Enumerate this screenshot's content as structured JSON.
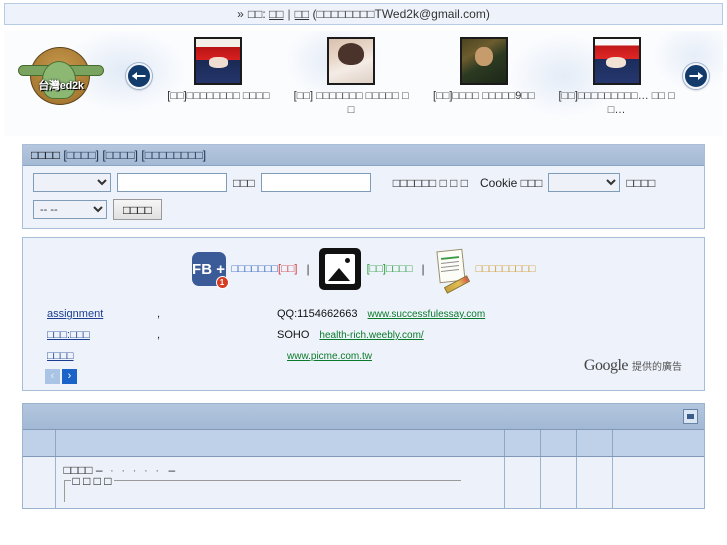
{
  "topbar": {
    "chevron": "»",
    "label_prefix": "□□:",
    "link_1": "□□",
    "separator": "|",
    "link_2": "□□",
    "paren_note": "(□□□□□□□□TWed2k@gmail.com)",
    "email": "TWed2k@gmail.com"
  },
  "logo": {
    "text": "台灣ed2k",
    "alt": "taiwan-ed2k-logo"
  },
  "carousel": {
    "prev_label": "←",
    "next_label": "→",
    "slides": [
      {
        "caption": "[□□]□□□□□□□□ □□□□",
        "avatar": "red-haired-anime-boy",
        "box_counts": [
          2,
          8,
          4
        ]
      },
      {
        "caption": "[□□] □□□□□□□ □□□□□ □□",
        "avatar": "woman-photo",
        "box_counts": [
          2,
          7,
          5,
          2
        ]
      },
      {
        "caption": "[□□]□□□□ □□□□□9□□",
        "avatar": "mona-lisa",
        "box_counts": [
          2,
          4,
          5,
          2
        ]
      },
      {
        "caption": "[□□]□□□□□□□□□… □□ □□…",
        "avatar": "red-haired-anime-boy-2",
        "box_counts": [
          2,
          9,
          2,
          2
        ]
      }
    ]
  },
  "search": {
    "header_title": "□□□□",
    "header_tag_1": "[□□□□]",
    "header_tag_2": "[□□□□]",
    "header_tag_3": "[□□□□□□□□]",
    "select_type_value": "",
    "keyword_value": "",
    "field_label": "□□□",
    "second_input_value": "",
    "checkbox_label": "□□□□□□ □ □ □",
    "cookie_label": "Cookie □□□",
    "cookie_select_value": "",
    "cookie_suffix_label": "□□□□",
    "range_select_value": "--  --",
    "submit_label": "□□□□"
  },
  "ads": {
    "fb_label": "FB +",
    "fb_count": "1",
    "link_fb_text": "□□□□□□□",
    "link_fb_tag": "[□□]",
    "link_img_tag": "[□□]",
    "link_img_text": "□□□□",
    "link_doc_text": "□□□□□□□□□",
    "entries": [
      {
        "title": "assignment",
        "mid": ",",
        "body": "QQ:1154662663",
        "url": "www.successfulessay.com"
      },
      {
        "title": "□□□:□□□",
        "mid": ",",
        "body": "SOHO",
        "url": "health-rich.weebly.com/"
      },
      {
        "title": "□□□□",
        "mid": "",
        "body": "",
        "url": "www.picme.com.tw"
      }
    ],
    "pager_prev": "‹",
    "pager_next": "›",
    "google_word": "Google",
    "google_suffix": "提供的廣告"
  },
  "list": {
    "collapse_title": "collapse",
    "columns": [
      "",
      "",
      "",
      "",
      "",
      ""
    ],
    "rows": [
      {
        "title": "□□□□",
        "dash": "–",
        "dots": "· · · · ·",
        "dash2": "–",
        "fieldset_legend": "□ □ □ □",
        "n1": "",
        "n2": "",
        "n3": "",
        "last": ""
      }
    ]
  },
  "colors": {
    "accent_blue": "#1a3d8f",
    "link_green": "#0a7a2a",
    "panel_header": "#a4b9d4",
    "panel_bg": "#eef3fb",
    "border": "#a8bed8",
    "fb_blue": "#3b5a98",
    "badge_red": "#d63b24"
  }
}
